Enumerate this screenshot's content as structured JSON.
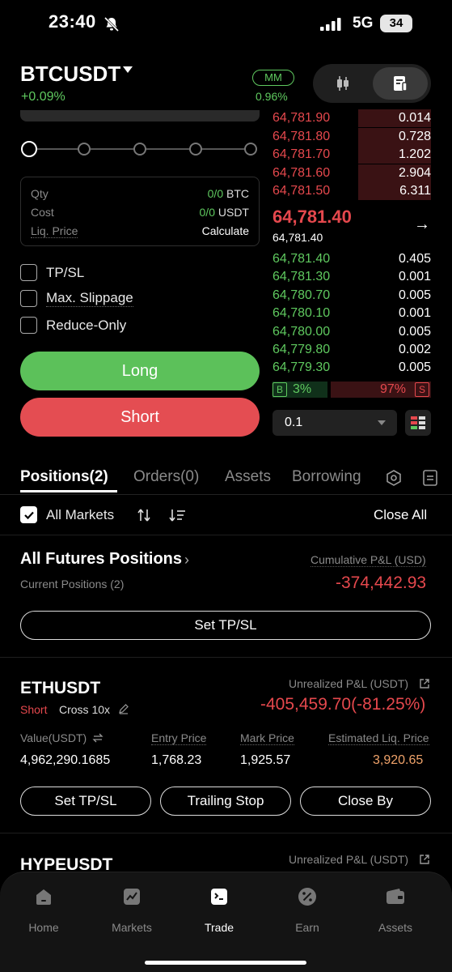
{
  "status_bar": {
    "time": "23:40",
    "network": "5G",
    "battery": "34"
  },
  "header": {
    "symbol": "BTCUSDT",
    "change": "+0.09%",
    "mm_label": "MM",
    "mm_value": "0.96%"
  },
  "order_form": {
    "slider_steps": 5,
    "info": {
      "qty_label": "Qty",
      "qty_green": "0/0",
      "qty_unit": "BTC",
      "cost_label": "Cost",
      "cost_green": "0/0",
      "cost_unit": "USDT",
      "liq_label": "Liq. Price",
      "liq_value": "Calculate"
    },
    "options": [
      "TP/SL",
      "Max. Slippage",
      "Reduce-Only"
    ],
    "long_label": "Long",
    "short_label": "Short"
  },
  "order_book": {
    "asks": [
      {
        "price": "64,781.90",
        "qty": "0.014",
        "depth": 0.46
      },
      {
        "price": "64,781.80",
        "qty": "0.728",
        "depth": 0.46
      },
      {
        "price": "64,781.70",
        "qty": "1.202",
        "depth": 0.46
      },
      {
        "price": "64,781.60",
        "qty": "2.904",
        "depth": 0.46
      },
      {
        "price": "64,781.50",
        "qty": "6.311",
        "depth": 0.46
      }
    ],
    "last_price": "64,781.40",
    "mark_price": "64,781.40",
    "bids": [
      {
        "price": "64,781.40",
        "qty": "0.405",
        "depth": 0.0
      },
      {
        "price": "64,781.30",
        "qty": "0.001",
        "depth": 0.0
      },
      {
        "price": "64,780.70",
        "qty": "0.005",
        "depth": 0.0
      },
      {
        "price": "64,780.10",
        "qty": "0.001",
        "depth": 0.0
      },
      {
        "price": "64,780.00",
        "qty": "0.005",
        "depth": 0.0
      },
      {
        "price": "64,779.80",
        "qty": "0.002",
        "depth": 0.0
      },
      {
        "price": "64,779.30",
        "qty": "0.005",
        "depth": 0.0
      }
    ],
    "buy_tag": "B",
    "buy_pct": "3%",
    "sell_tag": "S",
    "sell_pct": "97%",
    "depth_value": "0.1"
  },
  "tabs": [
    "Positions(2)",
    "Orders(0)",
    "Assets",
    "Borrowing"
  ],
  "filter": {
    "label": "All Markets",
    "close_all": "Close All"
  },
  "summary": {
    "title": "All Futures Positions",
    "cum_label": "Cumulative P&L (USD)",
    "current_positions": "Current Positions (2)",
    "cum_value": "-374,442.93",
    "set_tpsl": "Set TP/SL"
  },
  "positions": [
    {
      "symbol": "ETHUSDT",
      "side": "Short",
      "mode": "Cross 10x",
      "upl_label": "Unrealized P&L (USDT)",
      "upl_value": "-405,459.70(-81.25%)",
      "value_label": "Value(USDT)",
      "value": "4,962,290.1685",
      "entry_label": "Entry Price",
      "entry": "1,768.23",
      "mark_label": "Mark Price",
      "mark": "1,925.57",
      "liq_label": "Estimated Liq. Price",
      "liq": "3,920.65",
      "actions": [
        "Set TP/SL",
        "Trailing Stop",
        "Close By"
      ]
    },
    {
      "symbol": "HYPEUSDT",
      "upl_label": "Unrealized P&L (USDT)"
    }
  ],
  "bottom_nav": [
    "Home",
    "Markets",
    "Trade",
    "Earn",
    "Assets"
  ],
  "colors": {
    "green": "#5fc95f",
    "red": "#e5484d",
    "long_bg": "#5cc15a",
    "short_bg": "#e44d52"
  }
}
